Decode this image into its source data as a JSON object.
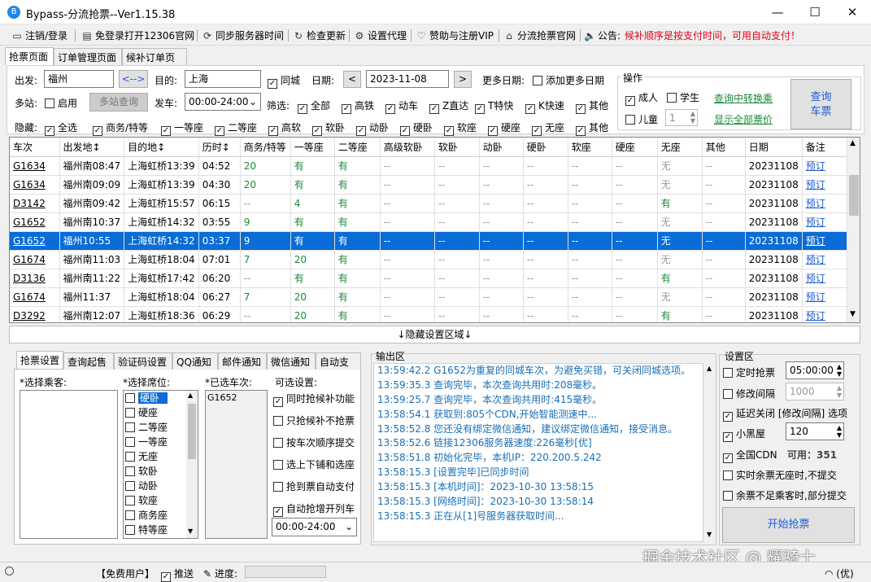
{
  "window": {
    "title": "Bypass-分流抢票--Ver1.15.38",
    "min": "—",
    "max": "☐",
    "close": "✕"
  },
  "menu": {
    "items": [
      {
        "icon": "▭",
        "label": "注销/登录"
      },
      {
        "icon": "▤",
        "label": "免登录打开12306官网"
      },
      {
        "icon": "⟳",
        "label": "同步服务器时间"
      },
      {
        "icon": "↻",
        "label": "检查更新"
      },
      {
        "icon": "⚙",
        "label": "设置代理"
      },
      {
        "icon": "♡",
        "label": "赞助与注册VIP"
      },
      {
        "icon": "⌂",
        "label": "分流抢票官网"
      },
      {
        "icon": "🔈",
        "label": "公告:"
      }
    ],
    "notice": "候补顺序是按支付时间，可用自动支付！"
  },
  "tabs": [
    "抢票页面",
    "订单管理页面",
    "候补订单页面"
  ],
  "search": {
    "from_label": "出发:",
    "from": "福州",
    "swap": "<-->",
    "to_label": "目的:",
    "to": "上海",
    "same_city": "同城",
    "date_label": "日期:",
    "date": "2023-11-08",
    "prev": "<",
    "next": ">",
    "more_dates_label": "更多日期:",
    "add_more_dates": "添加更多日期",
    "multi_label": "多站:",
    "enable": "启用",
    "multi_query": "多站查询",
    "depart_label": "发车:",
    "depart_range": "00:00-24:00",
    "filter_label": "筛选:",
    "filters": [
      "全部",
      "高铁",
      "动车",
      "Z直达",
      "T特快",
      "K快速",
      "其他"
    ],
    "hide_label": "隐藏:",
    "hides": [
      "全选",
      "商务/特等",
      "一等座",
      "二等座",
      "高软",
      "软卧",
      "动卧",
      "硬卧",
      "软座",
      "硬座",
      "无座",
      "其他"
    ],
    "ops_label": "操作",
    "adult": "成人",
    "student": "学生",
    "child": "儿童",
    "child_count": "1",
    "transfer_link": "查询中转换乘",
    "show_all_link": "显示全部票价",
    "query_btn_1": "查询",
    "query_btn_2": "车票"
  },
  "trains": {
    "headers": [
      "车次",
      "出发地↕",
      "目的地↕",
      "历时↕",
      "商务/特等",
      "一等座",
      "二等座",
      "高级软卧",
      "软卧",
      "动卧",
      "硬卧",
      "软座",
      "硬座",
      "无座",
      "其他",
      "日期",
      "备注"
    ],
    "rows": [
      [
        "G1634",
        "福州南08:47",
        "上海虹桥13:39",
        "04:52",
        "20",
        "有",
        "有",
        "--",
        "--",
        "--",
        "--",
        "--",
        "--",
        "无",
        "--",
        "20231108",
        "预订"
      ],
      [
        "G1634",
        "福州南09:09",
        "上海虹桥13:39",
        "04:30",
        "20",
        "有",
        "有",
        "--",
        "--",
        "--",
        "--",
        "--",
        "--",
        "无",
        "--",
        "20231108",
        "预订"
      ],
      [
        "D3142",
        "福州南09:42",
        "上海虹桥15:57",
        "06:15",
        "--",
        "4",
        "有",
        "--",
        "--",
        "--",
        "--",
        "--",
        "--",
        "有",
        "--",
        "20231108",
        "预订"
      ],
      [
        "G1652",
        "福州南10:37",
        "上海虹桥14:32",
        "03:55",
        "9",
        "有",
        "有",
        "--",
        "--",
        "--",
        "--",
        "--",
        "--",
        "无",
        "--",
        "20231108",
        "预订"
      ],
      [
        "G1652",
        "福州10:55",
        "上海虹桥14:32",
        "03:37",
        "9",
        "有",
        "有",
        "--",
        "--",
        "--",
        "--",
        "--",
        "--",
        "无",
        "--",
        "20231108",
        "预订"
      ],
      [
        "G1674",
        "福州南11:03",
        "上海虹桥18:04",
        "07:01",
        "7",
        "20",
        "有",
        "--",
        "--",
        "--",
        "--",
        "--",
        "--",
        "无",
        "--",
        "20231108",
        "预订"
      ],
      [
        "D3136",
        "福州南11:22",
        "上海虹桥17:42",
        "06:20",
        "--",
        "有",
        "有",
        "--",
        "--",
        "--",
        "--",
        "--",
        "--",
        "有",
        "--",
        "20231108",
        "预订"
      ],
      [
        "G1674",
        "福州11:37",
        "上海虹桥18:04",
        "06:27",
        "7",
        "20",
        "有",
        "--",
        "--",
        "--",
        "--",
        "--",
        "--",
        "无",
        "--",
        "20231108",
        "预订"
      ],
      [
        "D3292",
        "福州南12:07",
        "上海虹桥18:36",
        "06:29",
        "--",
        "20",
        "有",
        "--",
        "--",
        "--",
        "--",
        "--",
        "--",
        "有",
        "--",
        "20231108",
        "预订"
      ]
    ],
    "selected_row": 4
  },
  "hidden_settings": "↓隐藏设置区域↓",
  "bottom_tabs": [
    "抢票设置",
    "查询起售",
    "验证码设置",
    "QQ通知",
    "邮件通知",
    "微信通知",
    "自动支付"
  ],
  "settings": {
    "passengers_label": "*选择乘客:",
    "seats_label": "*选择席位:",
    "seats": [
      "硬卧",
      "硬座",
      "二等座",
      "一等座",
      "无座",
      "软卧",
      "动卧",
      "软座",
      "商务座",
      "特等座"
    ],
    "selected_trains_label": "*已选车次:",
    "selected_trains": [
      "G1652"
    ],
    "options_label": "可选设置:",
    "options": [
      {
        "label": "同时抢候补功能",
        "checked": true
      },
      {
        "label": "只抢候补不抢票",
        "checked": false
      },
      {
        "label": "按车次顺序提交",
        "checked": false
      },
      {
        "label": "选上下铺和选座",
        "checked": false
      },
      {
        "label": "抢到票自动支付",
        "checked": false
      },
      {
        "label": "自动抢增开列车",
        "checked": true
      }
    ],
    "time_range": "00:00-24:00"
  },
  "output": {
    "label": "输出区",
    "logs": [
      "13:59:42.2  G1652为重复的同城车次，为避免买错，可关闭同城选项。",
      "13:59:35.3  查询完毕，本次查询共用时:208毫秒。",
      "13:59:25.7  查询完毕，本次查询共用时:415毫秒。",
      "13:58:54.1  获取到:805个CDN,开始智能测速中...",
      "13:58:52.8  您还没有绑定微信通知，建议绑定微信通知，接受消息。",
      "13:58:52.6  链接12306服务器速度:226毫秒[优]",
      "13:58:51.8  初始化完毕，本机IP：220.200.5.242",
      "13:58:15.3  [设置完毕]已同步时间",
      "13:58:15.3  [本机时间]：2023-10-30 13:58:15",
      "13:58:15.3  [网络时间]：2023-10-30 13:58:14",
      "13:58:15.3  正在从[1]号服务器获取时间..."
    ]
  },
  "config": {
    "label": "设置区",
    "timed": "定时抢票",
    "timed_value": "05:00:00",
    "interval": "修改间隔",
    "interval_value": "1000",
    "delay": "延迟关闭 [修改间隔] 选项",
    "blacklist": "小黑屋",
    "blacklist_value": "120",
    "cdn": "全国CDN",
    "cdn_avail_label": "可用：",
    "cdn_avail": "351",
    "no_standing": "实时余票无座时,不提交",
    "partial": "余票不足乘客时,部分提交",
    "start_btn": "开始抢票"
  },
  "status": {
    "user": "【免费用户】",
    "push": "推送",
    "progress": "进度:",
    "network": "(优)"
  },
  "watermark": "掘金技术社区 @ 耀骑士"
}
